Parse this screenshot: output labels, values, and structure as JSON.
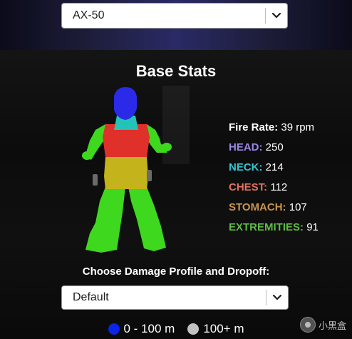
{
  "weapon_select": {
    "value": "AX-50"
  },
  "title": "Base Stats",
  "stats": [
    {
      "label": "Fire Rate:",
      "value": "39 rpm",
      "color": "#ffffff"
    },
    {
      "label": "HEAD:",
      "value": "250",
      "color": "#9a86e6"
    },
    {
      "label": "NECK:",
      "value": "214",
      "color": "#34c6d0"
    },
    {
      "label": "CHEST:",
      "value": "112",
      "color": "#e2725d"
    },
    {
      "label": "STOMACH:",
      "value": "107",
      "color": "#c9944e"
    },
    {
      "label": "EXTREMITIES:",
      "value": "91",
      "color": "#5dbb45"
    }
  ],
  "zone_colors": {
    "head": "#2a2ae8",
    "neck": "#23c3b9",
    "chest": "#e0302a",
    "stomach": "#c4b31a",
    "extremities": "#3ed81f"
  },
  "profile_prompt": "Choose Damage Profile and Dropoff:",
  "profile_select": {
    "value": "Default"
  },
  "legend": [
    {
      "label": "0 - 100 m",
      "color": "#0b24e6"
    },
    {
      "label": "100+ m",
      "color": "#c2c2c2"
    }
  ],
  "watermark": {
    "text": "小黑盒"
  }
}
